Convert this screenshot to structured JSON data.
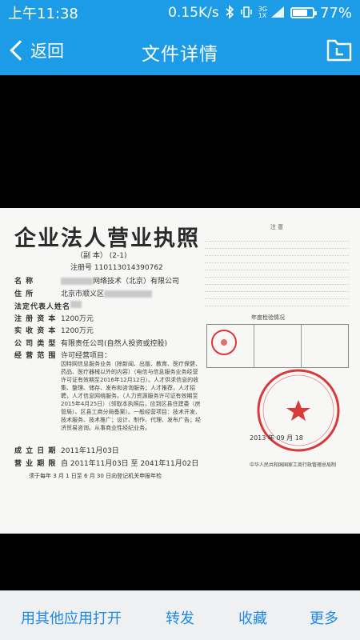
{
  "status_bar": {
    "time": "上午11:38",
    "speed": "0.15K/s",
    "network_top": "3G",
    "network_bottom": "1X",
    "battery_level": 0.77,
    "battery": "77%"
  },
  "header": {
    "back_label": "返回",
    "title": "文件详情"
  },
  "document": {
    "title": "企业法人营业执照",
    "copy_label": "（副    本）",
    "copy_no": "(2-1)",
    "reg_label": "注册号",
    "reg_no": "110113014390762",
    "fields": [
      {
        "key": "名    称",
        "value": "网络技术（北京）有限公司"
      },
      {
        "key": "住    所",
        "value": "北京市顺义区"
      },
      {
        "key": "法定代表人姓名",
        "value": ""
      },
      {
        "key": "注 册 资 本",
        "value": "1200万元"
      },
      {
        "key": "实 收 资 本",
        "value": "1200万元"
      },
      {
        "key": "公 司 类 型",
        "value": "有限责任公司(自然人投资或控股)"
      },
      {
        "key": "经 营 范 围",
        "value": "许可经营项目："
      }
    ],
    "scope_text": "因特网信息服务业务（除新闻、出版、教育、医疗保健、药品、医疗器械以外的内容）（电信与信息服务业务经营许可证有效期至2016年12月12日）。人才供求信息的收集、整理、储存、发布和咨询服务；人才推荐，人才招聘，人才信息网络服务。（人力资源服务许可证有效期至2015年4月25日）（领取本执照后，应到区县住建委（房管局）、区县工商分局备案）。一般经营项目：技术开发、技术服务、技术推广；设计、制作、代理、发布广告；经济贸易咨询。从事商业性经纪业务。",
    "established_key": "成 立 日 期",
    "established": "2011年11月03日",
    "term_key": "营 业 期 限",
    "term": "自 2011年11月03日 至 2041年11月02日",
    "footer_note": "须于每年 3 月 1 日至 6 月 30 日向登记机关申报年检",
    "notice_title": "注    意",
    "annual_title": "年度检验情况",
    "issue_date": "2013 年 09 月 18",
    "authority": "中华人民共和国国家工商行政管理总局制"
  },
  "actions": [
    {
      "label": "用其他应用打开"
    },
    {
      "label": "转发"
    },
    {
      "label": "收藏"
    },
    {
      "label": "更多"
    }
  ],
  "colors": {
    "accent": "#1c9be6",
    "action_text": "#1e88e5",
    "stamp": "#d63a3a"
  },
  "icons": {
    "back": "chevron-left-icon",
    "folder": "folder-icon",
    "bluetooth": "bluetooth-icon",
    "mute": "vibrate-icon",
    "signal": "signal-icon",
    "battery": "battery-icon"
  }
}
